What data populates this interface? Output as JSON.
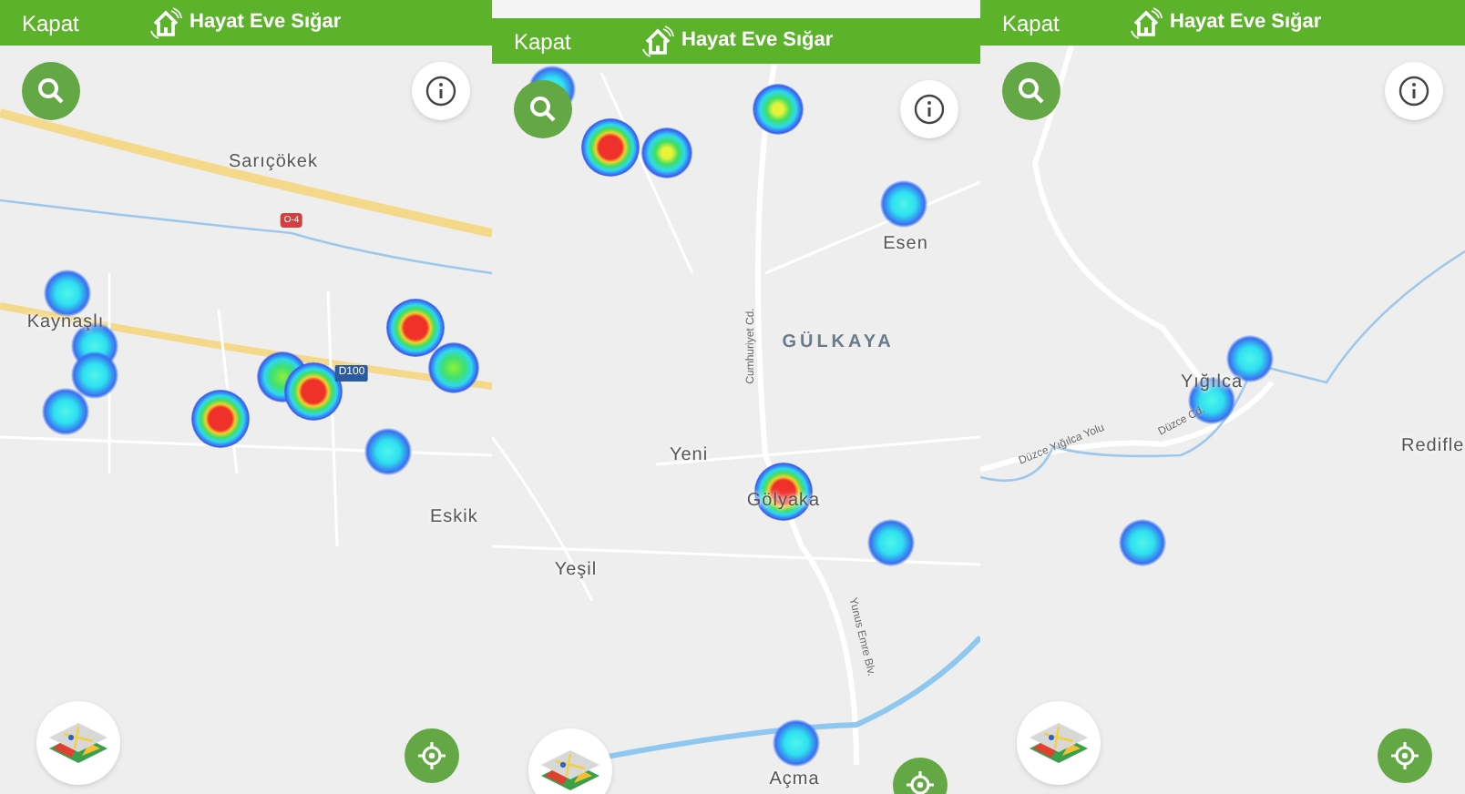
{
  "panels": [
    {
      "header": {
        "close": "Kapat",
        "title": "Hayat Eve Sığar"
      },
      "map_labels": [
        {
          "text": "Sarıçökek",
          "kind": "place"
        },
        {
          "text": "O-4",
          "kind": "shield_red"
        },
        {
          "text": "Kaynaşlı",
          "kind": "place"
        },
        {
          "text": "D100",
          "kind": "shield"
        },
        {
          "text": "Eskik",
          "kind": "place"
        }
      ]
    },
    {
      "header": {
        "close": "Kapat",
        "title": "Hayat Eve Sığar"
      },
      "map_labels": [
        {
          "text": "Esen",
          "kind": "place"
        },
        {
          "text": "Cumhuriyet Cd.",
          "kind": "street"
        },
        {
          "text": "GÜLKAYA",
          "kind": "district"
        },
        {
          "text": "Yeni",
          "kind": "place"
        },
        {
          "text": "Gölyaka",
          "kind": "place"
        },
        {
          "text": "Yeşil",
          "kind": "place"
        },
        {
          "text": "Yunus Emre Blv.",
          "kind": "street"
        },
        {
          "text": "Açma",
          "kind": "place"
        }
      ]
    },
    {
      "header": {
        "close": "Kapat",
        "title": "Hayat Eve Sığar"
      },
      "map_labels": [
        {
          "text": "Yığılca",
          "kind": "place"
        },
        {
          "text": "Düzce Yığılca Yolu",
          "kind": "street"
        },
        {
          "text": "Düzce Cd.",
          "kind": "street"
        },
        {
          "text": "Redifle",
          "kind": "place"
        }
      ]
    }
  ]
}
